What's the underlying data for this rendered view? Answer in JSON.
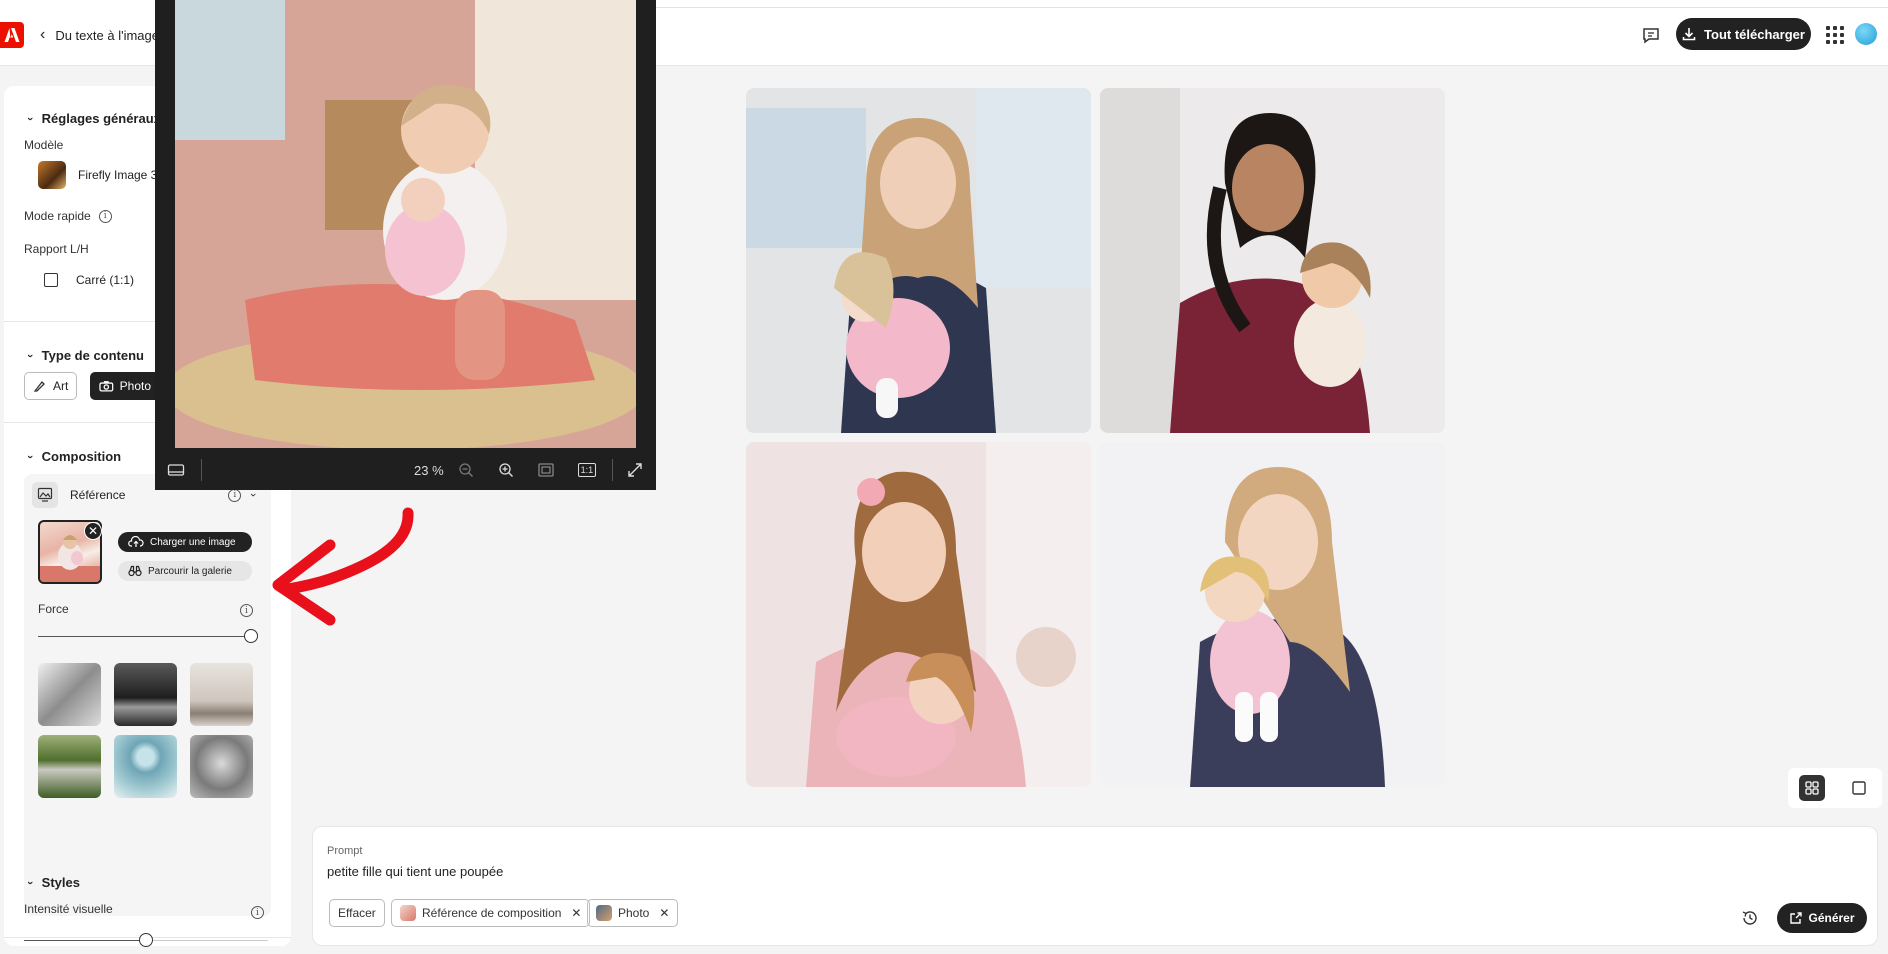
{
  "header": {
    "back_label": "Du texte à l'image",
    "download_label": "Tout télécharger"
  },
  "general": {
    "title": "Réglages généraux",
    "model_label": "Modèle",
    "model_value": "Firefly Image 3",
    "fast_mode_label": "Mode rapide",
    "ratio_label": "Rapport L/H",
    "ratio_value": "Carré (1:1)"
  },
  "content_type": {
    "title": "Type de contenu",
    "options": [
      "Art",
      "Photo"
    ],
    "selected": "Photo"
  },
  "composition": {
    "title": "Composition",
    "reference_label": "Référence",
    "upload_label": "Charger une image",
    "browse_label": "Parcourir la galerie",
    "force_label": "Force",
    "force_value": 1.0
  },
  "styles": {
    "title": "Styles",
    "intensity_label": "Intensité visuelle",
    "intensity_value": 0.5
  },
  "preview": {
    "zoom": "23 %",
    "actual_size_label": "1:1"
  },
  "prompt": {
    "label": "Prompt",
    "text": "petite fille qui tient une poupée",
    "clear_label": "Effacer",
    "tags": [
      "Référence de composition",
      "Photo"
    ],
    "generate_label": "Générer"
  },
  "colors": {
    "accent_dark": "#222222",
    "adobe_red": "#eb1000",
    "annotation_red": "#e8101b"
  }
}
